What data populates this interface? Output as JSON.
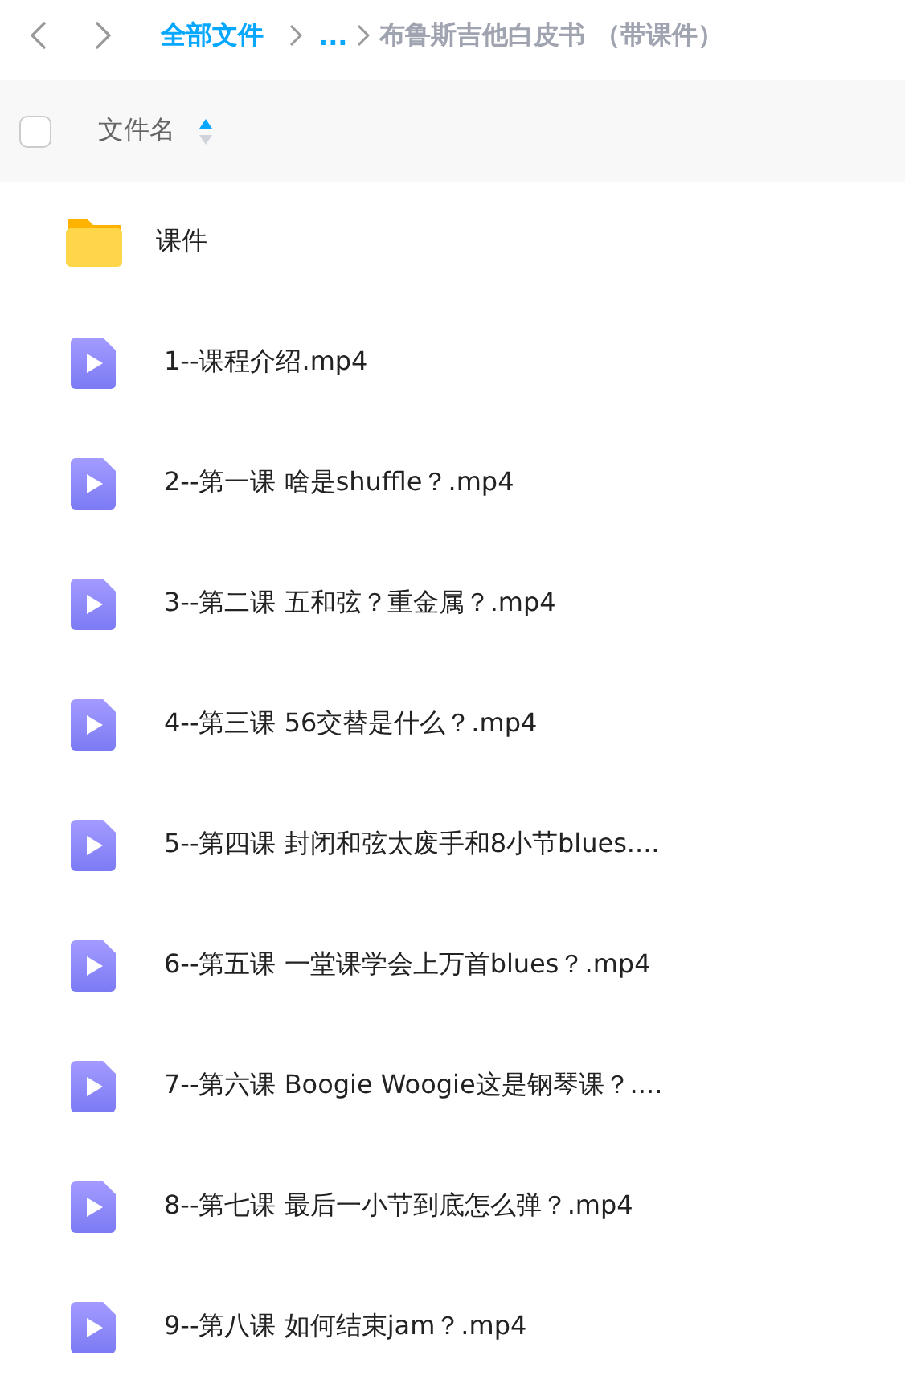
{
  "breadcrumb": [
    {
      "label": "全部文件",
      "kind": "link"
    },
    {
      "label": "...",
      "kind": "link"
    },
    {
      "label": "布鲁斯吉他白皮书 （带课件）",
      "kind": "current"
    }
  ],
  "header": {
    "select_all": {
      "checked": false
    },
    "column": "文件名",
    "sort_ascending": true
  },
  "files": [
    {
      "kind": "folder",
      "name": "课件"
    },
    {
      "kind": "video",
      "name": "1--课程介绍.mp4"
    },
    {
      "kind": "video",
      "name": "2--第一课 啥是shuffle？.mp4"
    },
    {
      "kind": "video",
      "name": "3--第二课 五和弦？重金属？.mp4"
    },
    {
      "kind": "video",
      "name": "4--第三课 56交替是什么？.mp4"
    },
    {
      "kind": "video",
      "name": "5--第四课 封闭和弦太废手和8小节blues...."
    },
    {
      "kind": "video",
      "name": "6--第五课 一堂课学会上万首blues？.mp4"
    },
    {
      "kind": "video",
      "name": "7--第六课 Boogie Woogie这是钢琴课？...."
    },
    {
      "kind": "video",
      "name": "8--第七课 最后一小节到底怎么弹？.mp4"
    },
    {
      "kind": "video",
      "name": "9--第八课 如何结束jam？.mp4"
    }
  ]
}
